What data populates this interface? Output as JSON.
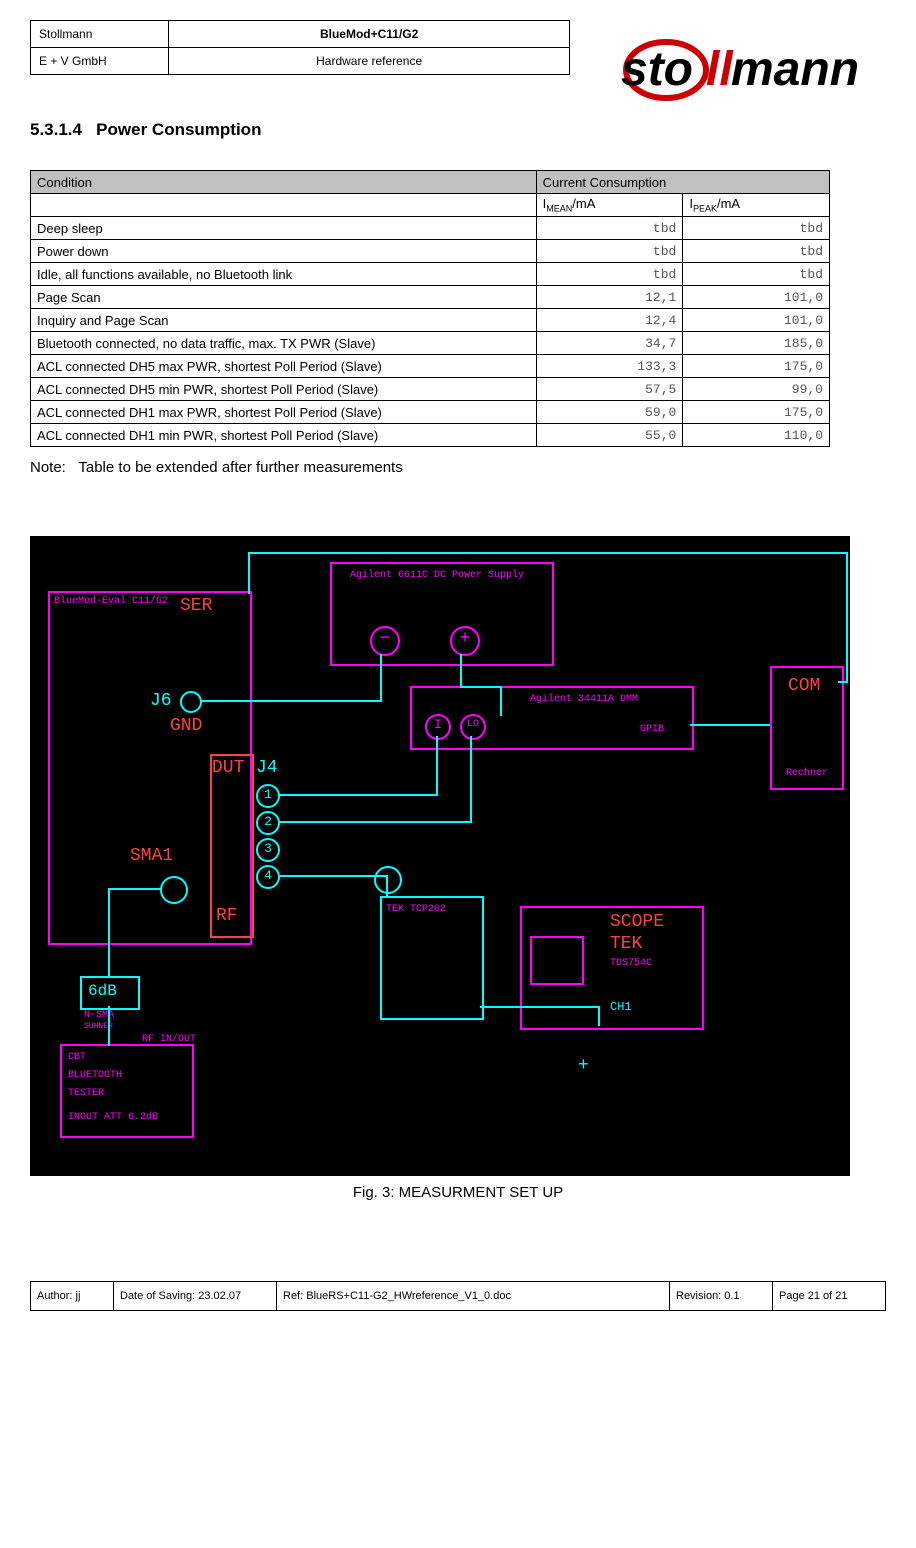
{
  "header": {
    "left_top": "Stollmann",
    "left_bottom": "E + V GmbH",
    "mid_top": "BlueMod+C11/G2",
    "mid_bottom": "Hardware reference",
    "logo_text": "stollmann"
  },
  "section_number": "5.3.1.4",
  "section_title": "Power Consumption",
  "table": {
    "th1": "Condition",
    "th2": "Current Consumption",
    "sub_mean_prefix": "I",
    "sub_mean_sub": "MEAN",
    "sub_mean_suffix": "/mA",
    "sub_peak_prefix": "I",
    "sub_peak_sub": "PEAK",
    "sub_peak_suffix": "/mA",
    "rows": [
      {
        "condition": "Deep sleep",
        "mean": "tbd",
        "peak": "tbd"
      },
      {
        "condition": "Power down",
        "mean": "tbd",
        "peak": "tbd"
      },
      {
        "condition": "Idle, all functions available, no Bluetooth link",
        "mean": "tbd",
        "peak": "tbd"
      },
      {
        "condition": "Page Scan",
        "mean": "12,1",
        "peak": "101,0"
      },
      {
        "condition": "Inquiry and Page Scan",
        "mean": "12,4",
        "peak": "101,0"
      },
      {
        "condition": "Bluetooth connected, no data traffic, max. TX PWR (Slave)",
        "mean": "34,7",
        "peak": "185,0"
      },
      {
        "condition": "ACL connected DH5 max PWR, shortest Poll Period (Slave)",
        "mean": "133,3",
        "peak": "175,0"
      },
      {
        "condition": "ACL connected DH5 min PWR, shortest Poll Period (Slave)",
        "mean": "57,5",
        "peak": "99,0"
      },
      {
        "condition": "ACL connected DH1 max PWR, shortest Poll Period (Slave)",
        "mean": "59,0",
        "peak": "175,0"
      },
      {
        "condition": "ACL connected DH1 min PWR, shortest Poll Period (Slave)",
        "mean": "55,0",
        "peak": "110,0"
      }
    ]
  },
  "note_label": "Note:",
  "note_text": "Table to be extended after further measurements",
  "diagram": {
    "bluemod": "BlueMod-Eval C11/G2",
    "ser": "SER",
    "j6": "J6",
    "gnd": "GND",
    "dut": "DUT",
    "j4": "J4",
    "sma1": "SMA1",
    "rf": "RF",
    "att6db": "6dB",
    "nsma": "N-SMA",
    "suhner": "SUHNER",
    "rfinout": "RF IN/OUT",
    "cbt": "CBT",
    "bttester1": "BLUETOOTH",
    "bttester2": "TESTER",
    "inout_att": "INOUT ATT 6.2dB",
    "agilent_ps": "Agilent 6611C DC Power Supply",
    "agilent_dmm": "Agilent 34411A DMM",
    "hi": "I",
    "lo": "LO",
    "tek_tcp": "TEK TCP202",
    "com": "COM",
    "gpib": "GPIB",
    "rechner": "Rechner",
    "scope": "SCOPE",
    "tek": "TEK",
    "tds": "TDS754C",
    "ch1": "CH1",
    "p1": "1",
    "p2": "2",
    "p3": "3",
    "p4": "4",
    "minus": "−",
    "plus": "+"
  },
  "caption": "Fig. 3: MEASURMENT SET UP",
  "footer": {
    "author": "Author: jj",
    "date": "Date of Saving: 23.02.07",
    "ref": "Ref: BlueRS+C11-G2_HWreference_V1_0.doc",
    "revision": "Revision: 0.1",
    "page": "Page 21 of 21"
  }
}
